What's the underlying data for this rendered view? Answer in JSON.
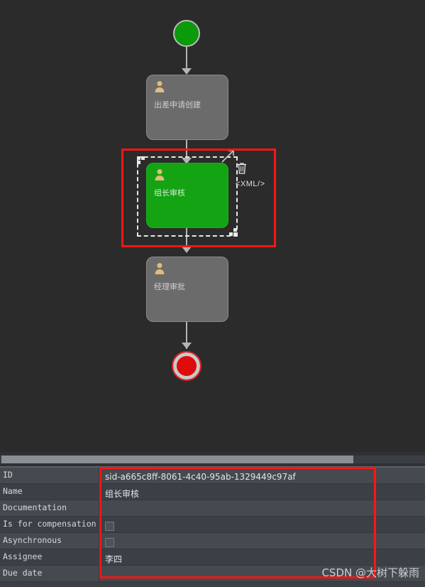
{
  "app": {
    "canvas_bg": "#2b2b2b",
    "highlight_color": "#ff1414",
    "watermark": "CSDN @大树下躲雨"
  },
  "diagram": {
    "nodes": [
      {
        "id": "start",
        "type": "start-event",
        "label": "",
        "fill": "#0a9a0a"
      },
      {
        "id": "task1",
        "type": "user-task",
        "label": "出差申请创建",
        "fill": "#6b6b6b"
      },
      {
        "id": "task2",
        "type": "user-task",
        "label": "组长审核",
        "fill": "#13a313",
        "selected": true
      },
      {
        "id": "task3",
        "type": "user-task",
        "label": "经理审批",
        "fill": "#6b6b6b"
      },
      {
        "id": "end",
        "type": "end-event",
        "label": "",
        "fill": "#e00b0b"
      }
    ],
    "selection_toolbar": {
      "delete_label": "",
      "xml_label": "<XML/>"
    }
  },
  "properties": {
    "rows": [
      {
        "label": "ID",
        "value": "sid-a665c8ff-8061-4c40-95ab-1329449c97af",
        "kind": "text"
      },
      {
        "label": "Name",
        "value": "组长审核",
        "kind": "text"
      },
      {
        "label": "Documentation",
        "value": "",
        "kind": "text"
      },
      {
        "label": "Is for compensation",
        "value": "",
        "kind": "checkbox",
        "checked": false
      },
      {
        "label": "Asynchronous",
        "value": "",
        "kind": "checkbox",
        "checked": false
      },
      {
        "label": "Assignee",
        "value": "李四",
        "kind": "text"
      },
      {
        "label": "Due date",
        "value": "",
        "kind": "text"
      }
    ]
  },
  "scrollbar": {
    "orientation": "horizontal",
    "thumb_percent": 83
  }
}
